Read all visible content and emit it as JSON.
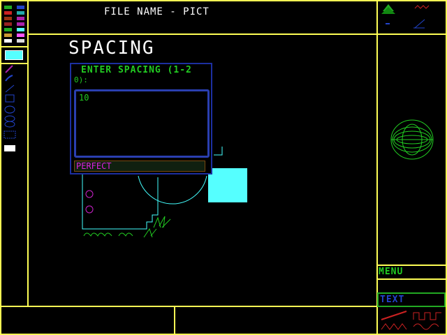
{
  "header": {
    "title": "FILE NAME - PICT"
  },
  "canvas": {
    "heading": "SPACING"
  },
  "dialog": {
    "prompt_line1": "ENTER SPACING (1-2",
    "prompt_line2": "0):",
    "input_value": "10",
    "status_text": "PERFECT"
  },
  "right_panel": {
    "menu_label": "MENU",
    "text_label": "TEXT"
  },
  "palette": {
    "left_column": [
      "#22aa22",
      "#cc2222",
      "#993311",
      "#992222",
      "#22aa22",
      "#cc9933",
      "#ffffff"
    ],
    "right_column": [
      "#2244cc",
      "#22aaaa",
      "#aa22aa",
      "#aa22aa",
      "#55ffff",
      "#ff55ff",
      "#dddddd"
    ],
    "selected_color": "#55ffff"
  },
  "colors": {
    "frame": "#ffff55",
    "accent_green": "#22cc22",
    "accent_magenta": "#dd22dd",
    "dialog_border": "#1c2fa0"
  },
  "tools": [
    "pencil-tool",
    "brush-tool",
    "line-tool",
    "rectangle-tool",
    "ellipse-tool",
    "text-tool",
    "fill-tool",
    "erase-tool"
  ]
}
